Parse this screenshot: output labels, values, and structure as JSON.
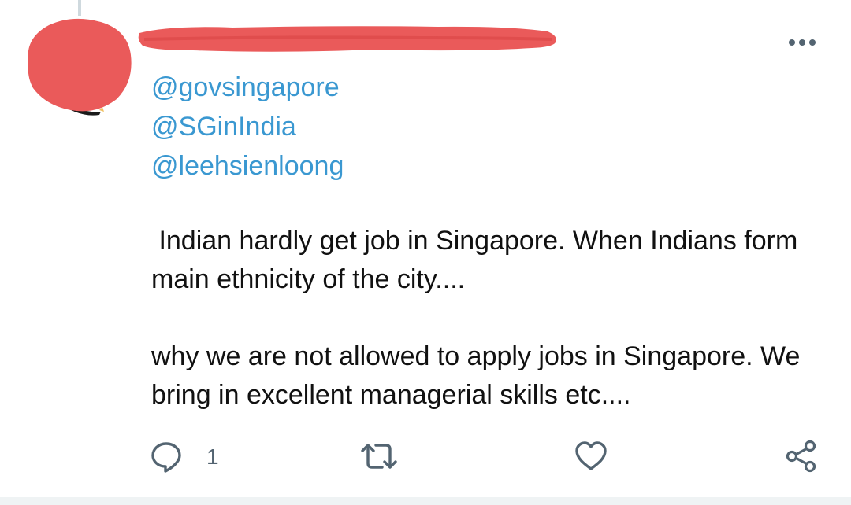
{
  "tweet": {
    "mentions": [
      "@govsingapore",
      "@SGinIndia",
      "@leehsienloong"
    ],
    "paragraphs": [
      " Indian hardly get job in Singapore. When Indians form main ethnicity of the city....",
      "why we are not allowed to apply jobs in Singapore. We bring in excellent managerial skills etc...."
    ]
  },
  "actions": {
    "reply_count": "1",
    "reply_icon": "reply-icon",
    "retweet_icon": "retweet-icon",
    "like_icon": "heart-icon",
    "share_icon": "share-icon",
    "more_icon": "more-horizontal-icon"
  },
  "colors": {
    "mention": "#3a98d1",
    "redaction": "#ea5a5a",
    "icon": "#536471",
    "text": "#111111"
  }
}
